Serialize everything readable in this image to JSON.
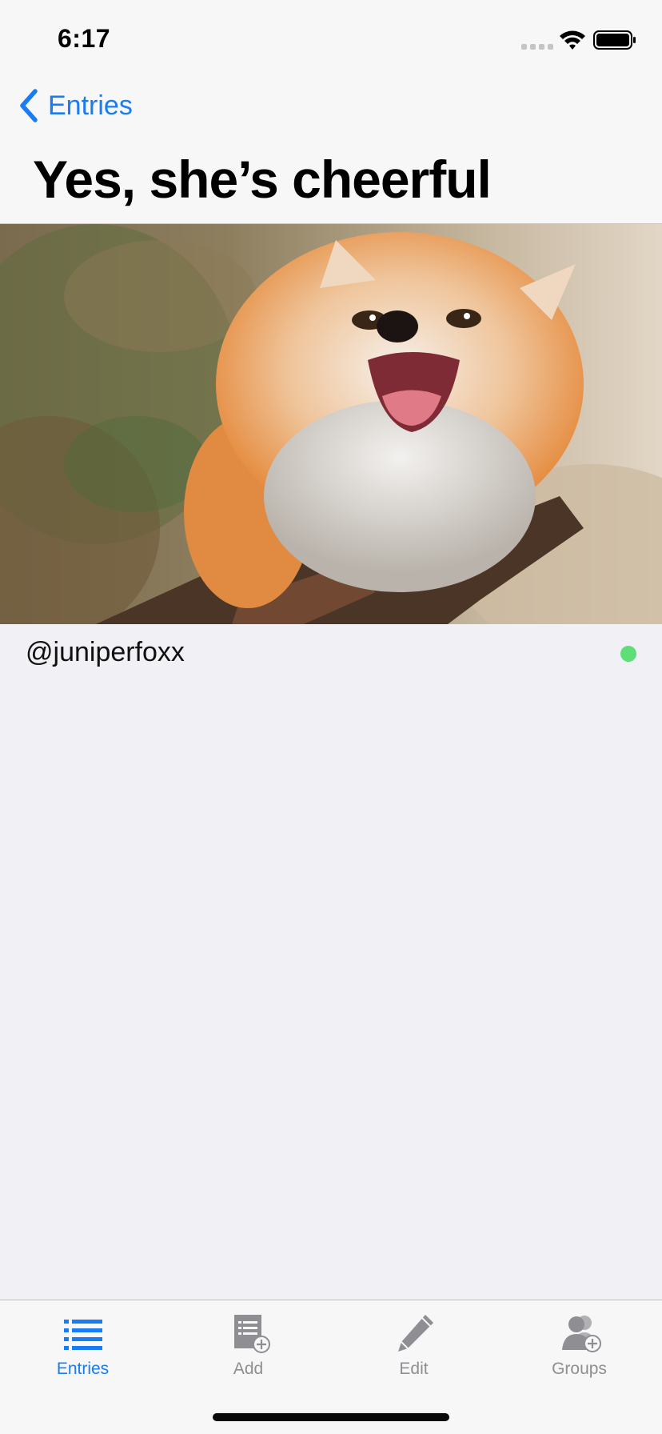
{
  "status_bar": {
    "time": "6:17"
  },
  "nav": {
    "back_label": "Entries",
    "title": "Yes, she’s cheerful"
  },
  "entry": {
    "photo_icon": "fox-photo",
    "username": "@juniperfoxx",
    "status_color": "#5dde76"
  },
  "tab_bar": {
    "tabs": [
      {
        "label": "Entries",
        "icon": "list-icon",
        "active": true
      },
      {
        "label": "Add",
        "icon": "add-document-icon",
        "active": false
      },
      {
        "label": "Edit",
        "icon": "pencil-icon",
        "active": false
      },
      {
        "label": "Groups",
        "icon": "add-group-icon",
        "active": false
      }
    ]
  },
  "colors": {
    "accent": "#1a7cf2",
    "inactive": "#8e8e93",
    "background": "#f0f0f5"
  }
}
